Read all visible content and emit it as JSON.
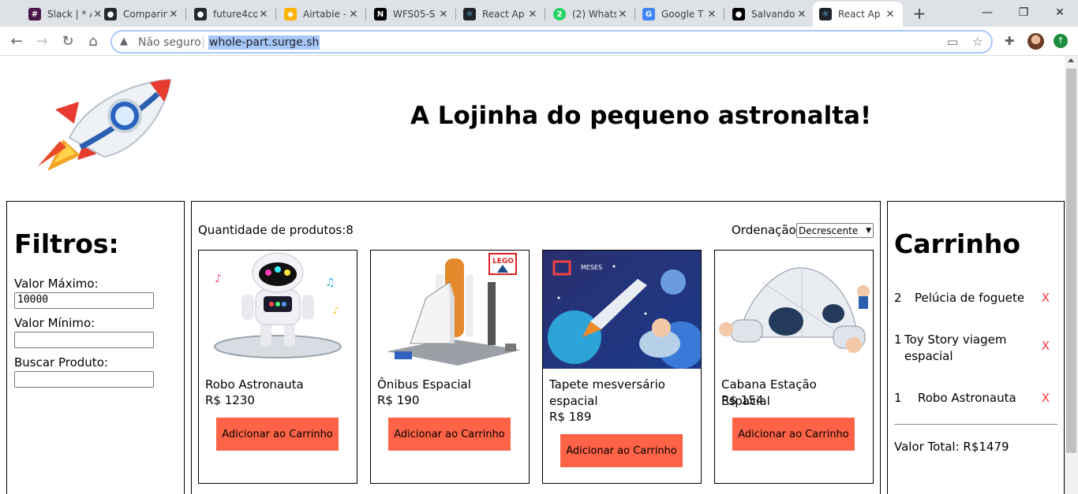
{
  "browser": {
    "tabs": [
      {
        "title": "Slack | * A",
        "fav_color": "#4a154b",
        "fav_glyph": "#"
      },
      {
        "title": "Comparin",
        "fav_color": "#24292e",
        "fav_glyph": "●"
      },
      {
        "title": "future4co",
        "fav_color": "#24292e",
        "fav_glyph": "●"
      },
      {
        "title": "Airtable -",
        "fav_color": "#fcb400",
        "fav_glyph": "◆"
      },
      {
        "title": "WFS05-S",
        "fav_color": "#000000",
        "fav_glyph": "N"
      },
      {
        "title": "React Ap",
        "fav_color": "#61dafb",
        "fav_glyph": "⚛"
      },
      {
        "title": "(2) Whats",
        "fav_color": "#25d366",
        "fav_glyph": "2"
      },
      {
        "title": "Google T",
        "fav_color": "#4285f4",
        "fav_glyph": "G"
      },
      {
        "title": "Salvando",
        "fav_color": "#000000",
        "fav_glyph": "●"
      },
      {
        "title": "React Ap",
        "fav_color": "#61dafb",
        "fav_glyph": "⚛",
        "active": true
      }
    ],
    "omnibox": {
      "security": "Não seguro",
      "url": "whole-part.surge.sh"
    }
  },
  "page": {
    "title": "A Lojinha do pequeno astronalta!",
    "filters": {
      "heading": "Filtros:",
      "max_label": "Valor Máximo:",
      "max_value": "10000",
      "min_label": "Valor Mínimo:",
      "min_value": "",
      "search_label": "Buscar Produto:",
      "search_value": ""
    },
    "products": {
      "count_label": "Quantidade de produtos:8",
      "sort_label": "Ordenação:",
      "sort_value": "Decrescente",
      "items": [
        {
          "name": "Robo Astronauta",
          "price": "R$ 1230",
          "button": "Adicionar ao Carrinho"
        },
        {
          "name": "Ônibus Espacial",
          "price": "R$ 190",
          "button": "Adicionar ao Carrinho"
        },
        {
          "name": "Tapete mesversário espacial",
          "price": "R$ 189",
          "button": "Adicionar ao Carrinho"
        },
        {
          "name": "Cabana Estação Espacial",
          "price": "R$ 154",
          "button": "Adicionar ao Carrinho"
        }
      ]
    },
    "cart": {
      "heading": "Carrinho",
      "items": [
        {
          "qty": "2",
          "name": "Pelúcia de foguete",
          "remove": "X"
        },
        {
          "qty": "1",
          "name": "Toy Story viagem espacial",
          "remove": "X"
        },
        {
          "qty": "1",
          "name": "Robo Astronauta",
          "remove": "X"
        }
      ],
      "total": "Valor Total: R$1479"
    }
  }
}
